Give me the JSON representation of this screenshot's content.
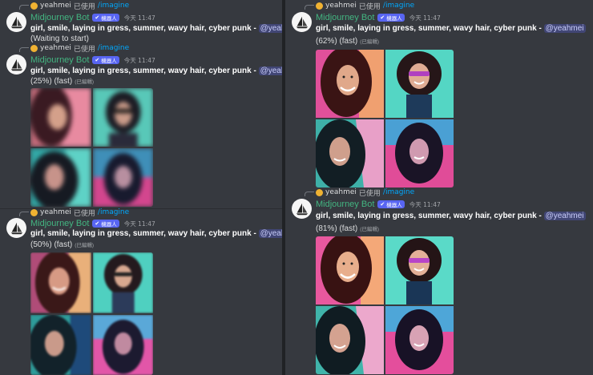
{
  "reply": {
    "user": "yeahmei",
    "used": "已使用",
    "command": "/imagine"
  },
  "bot": {
    "name": "Midjourney Bot",
    "badge": "機器人",
    "time": "今天 11:47"
  },
  "prompt": {
    "text": "girl, smile, laying in gress, summer, wavy hair, cyber punk - ",
    "mention": "@yeahmei"
  },
  "edited_label": "(已編輯)",
  "messages": [
    {
      "status": "(Waiting to start)"
    },
    {
      "status": "(25%) (fast)",
      "progress": 0.25
    },
    {
      "status": "(50%) (fast)",
      "progress": 0.5
    },
    {
      "status": "(62%) (fast)",
      "progress": 0.62
    },
    {
      "status": "(81%) (fast)",
      "progress": 0.81
    }
  ],
  "colors": {
    "accent": "#5865f2",
    "botname": "#43b581",
    "link": "#00a8fc",
    "mention_bg": "#414675"
  }
}
